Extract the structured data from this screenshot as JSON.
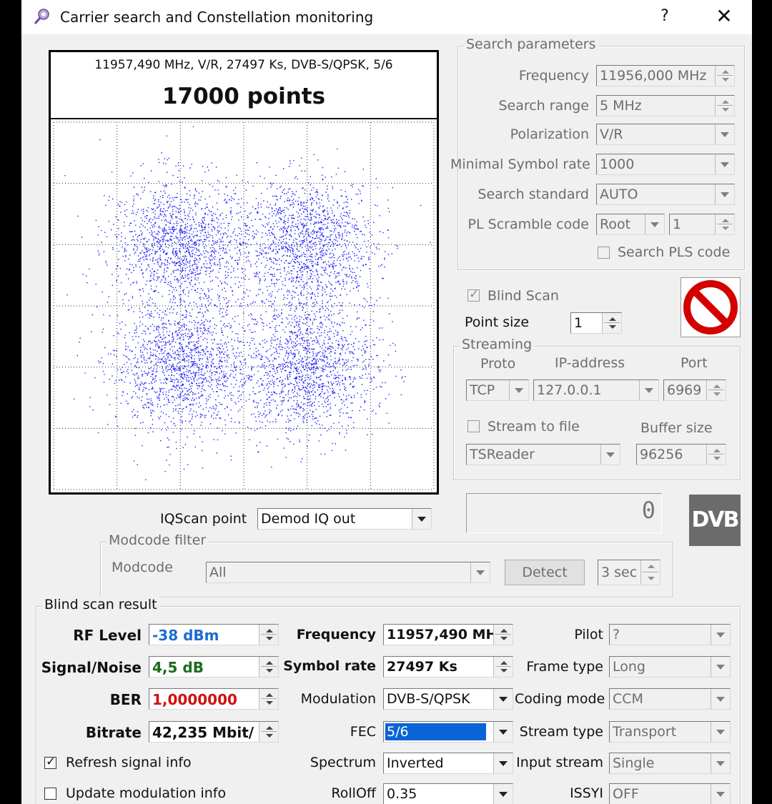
{
  "titlebar": {
    "title": "Carrier search and Constellation monitoring",
    "help": "?",
    "close": "✕"
  },
  "plot": {
    "subtitle": "11957,490 MHz, V/R, 27497 Ks, DVB-S/QPSK, 5/6",
    "title": "17000 points",
    "point_color": "#1a1aff"
  },
  "chart_data": {
    "type": "scatter",
    "title": "17000 points",
    "subtitle": "11957,490 MHz, V/R, 27497 Ks, DVB-S/QPSK, 5/6",
    "point_count": 17000,
    "constellation": "QPSK",
    "cluster_centers_approx": [
      [
        -0.5,
        0.5
      ],
      [
        0.5,
        0.5
      ],
      [
        -0.5,
        -0.5
      ],
      [
        0.5,
        -0.5
      ]
    ],
    "grid": true,
    "xlim": [
      -1.5,
      1.5
    ],
    "ylim": [
      -1.5,
      1.5
    ]
  },
  "search": {
    "title": "Search parameters",
    "frequency_label": "Frequency",
    "frequency_value": "11956,000 MHz",
    "range_label": "Search range",
    "range_value": "5 MHz",
    "polarization_label": "Polarization",
    "polarization_value": "V/R",
    "minsr_label": "Minimal Symbol rate",
    "minsr_value": "1000",
    "standard_label": "Search standard",
    "standard_value": "AUTO",
    "pls_label": "PL Scramble code",
    "pls_mode": "Root",
    "pls_value": "1",
    "search_pls_label": "Search PLS code"
  },
  "blind": {
    "label": "Blind Scan",
    "checked": true
  },
  "point_size": {
    "label": "Point size",
    "value": "1"
  },
  "streaming": {
    "title": "Streaming",
    "proto_label": "Proto",
    "ip_label": "IP-address",
    "port_label": "Port",
    "proto_value": "TCP",
    "ip_value": "127.0.0.1",
    "port_value": "6969",
    "to_file_label": "Stream to file",
    "buffer_label": "Buffer size",
    "reader_value": "TSReader",
    "buffer_value": "96256"
  },
  "counter": {
    "value": "0"
  },
  "dvb_logo": "DVB",
  "iqscan": {
    "label": "IQScan point",
    "value": "Demod IQ out"
  },
  "modcode": {
    "title": "Modcode filter",
    "label": "Modcode",
    "value": "All",
    "detect": "Detect",
    "interval": "3 sec"
  },
  "result": {
    "title": "Blind scan result",
    "rf_label": "RF Level",
    "rf_value": "-38 dBm",
    "rf_color": "#1c6dd0",
    "sn_label": "Signal/Noise",
    "sn_value": "4,5 dB",
    "sn_color": "#1e6b1e",
    "ber_label": "BER",
    "ber_value": "1,0000000",
    "ber_color": "#d01010",
    "bitrate_label": "Bitrate",
    "bitrate_value": "42,235 Mbit/",
    "freq_label": "Frequency",
    "freq_value": "11957,490 MH:",
    "sr_label": "Symbol rate",
    "sr_value": "27497 Ks",
    "mod_label": "Modulation",
    "mod_value": "DVB-S/QPSK",
    "fec_label": "FEC",
    "fec_value": "5/6",
    "spectrum_label": "Spectrum",
    "spectrum_value": "Inverted",
    "rolloff_label": "RollOff",
    "rolloff_value": "0.35",
    "pilot_label": "Pilot",
    "pilot_value": "?",
    "frame_label": "Frame type",
    "frame_value": "Long",
    "coding_label": "Coding mode",
    "coding_value": "CCM",
    "stream_label": "Stream type",
    "stream_value": "Transport",
    "input_label": "Input stream",
    "input_value": "Single",
    "issyi_label": "ISSYI",
    "issyi_value": "OFF",
    "refresh_label": "Refresh signal info",
    "refresh_checked": true,
    "update_label": "Update modulation info",
    "update_checked": false
  }
}
